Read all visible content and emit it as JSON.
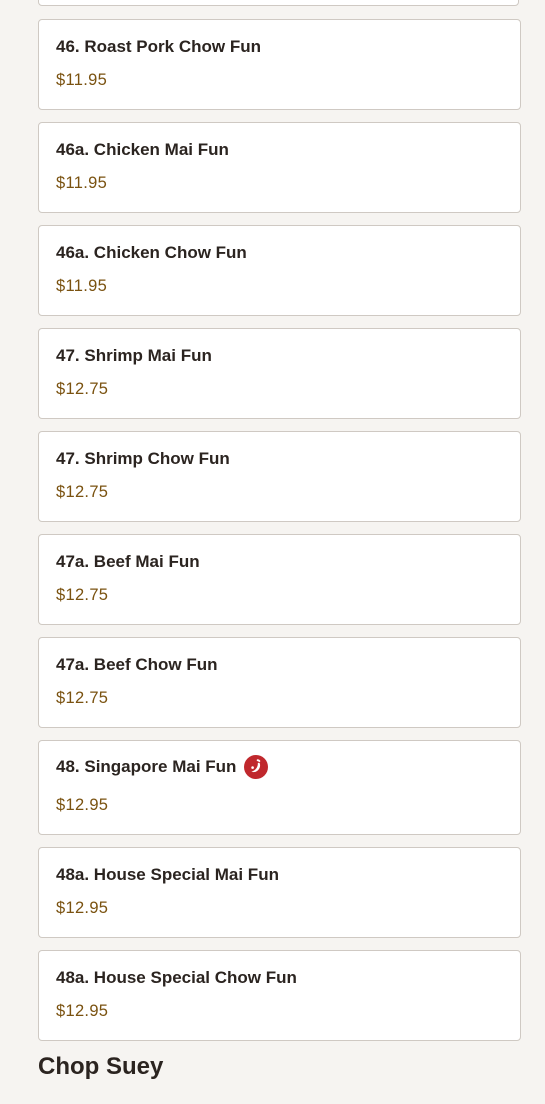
{
  "menu_items": [
    {
      "name": "46. Roast Pork Chow Fun",
      "price": "$11.95"
    },
    {
      "name": "46a. Chicken Mai Fun",
      "price": "$11.95"
    },
    {
      "name": "46a. Chicken Chow Fun",
      "price": "$11.95"
    },
    {
      "name": "47. Shrimp Mai Fun",
      "price": "$12.75"
    },
    {
      "name": "47. Shrimp Chow Fun",
      "price": "$12.75"
    },
    {
      "name": "47a. Beef Mai Fun",
      "price": "$12.75"
    },
    {
      "name": "47a. Beef Chow Fun",
      "price": "$12.75"
    },
    {
      "name": "48. Singapore Mai Fun",
      "price": "$12.95",
      "badge": "spicy-icon"
    },
    {
      "name": "48a. House Special Mai Fun",
      "price": "$12.95"
    },
    {
      "name": "48a. House Special Chow Fun",
      "price": "$12.95"
    }
  ],
  "next_section": {
    "title": "Chop Suey"
  },
  "colors": {
    "price": "#7a5210",
    "spicy": "#c0282d",
    "card_border": "#cfc9c3",
    "background": "#f6f4f1"
  }
}
